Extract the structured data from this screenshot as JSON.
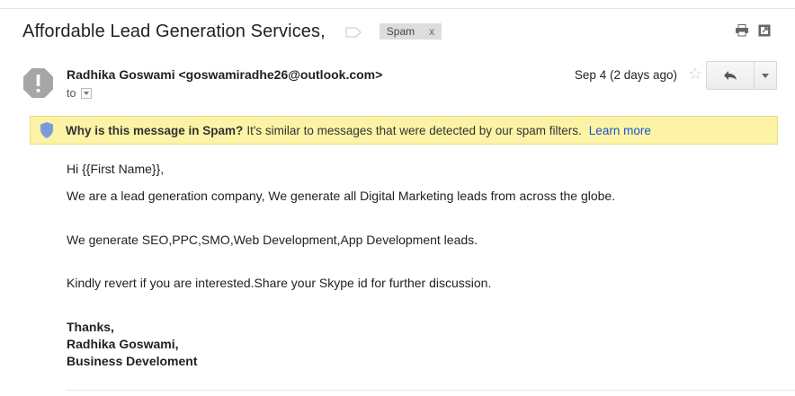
{
  "subject": "Affordable Lead Generation Services,",
  "labels": [
    {
      "name": "Spam",
      "remove": "x"
    }
  ],
  "sender": {
    "display": "Radhika Goswami <goswamiradhe26@outlook.com>",
    "to_label": "to"
  },
  "date": "Sep 4 (2 days ago)",
  "spam_banner": {
    "question": "Why is this message in Spam?",
    "explanation": "It's similar to messages that were detected by our spam filters.",
    "link": "Learn more"
  },
  "body": {
    "greeting": "Hi {{First Name}},",
    "para1": "We are a lead generation company, We generate all Digital Marketing leads from across the globe.",
    "para2": "We generate SEO,PPC,SMO,Web Development,App Development leads.",
    "para3": "Kindly revert if you are interested.Share your Skype id for further discussion.",
    "signature": [
      "Thanks,",
      "Radhika Goswami,",
      "Business Develoment"
    ]
  },
  "icons": {
    "avatar": "warning-avatar-icon",
    "label": "label-tag-icon",
    "print": "print-icon",
    "new_window": "new-window-icon",
    "star": "star-icon",
    "reply": "reply-icon",
    "more": "chevron-down-icon",
    "shield": "shield-icon"
  },
  "colors": {
    "banner_bg": "#fcf3a6",
    "link": "#1a55c6",
    "avatar": "#a6a6a6"
  }
}
